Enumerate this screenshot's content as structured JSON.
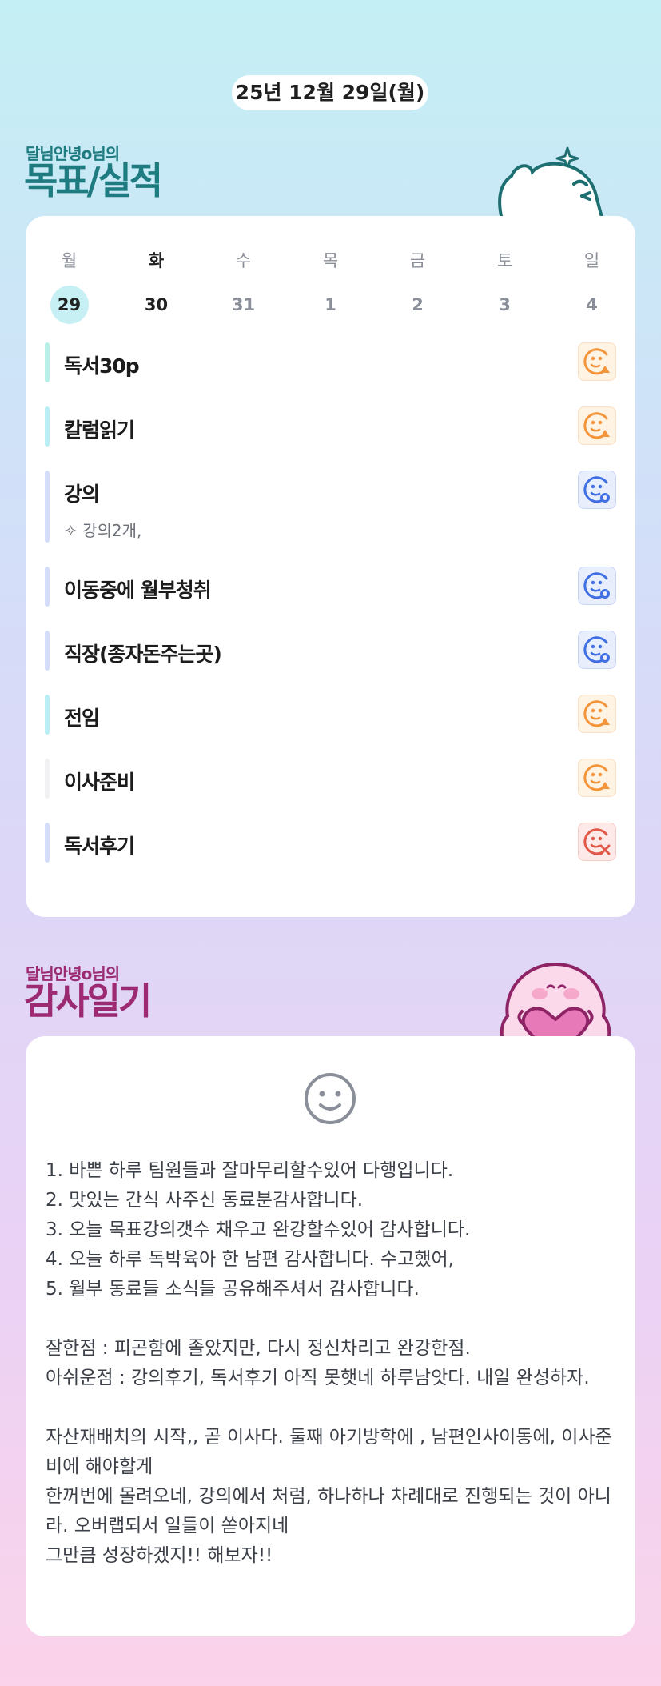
{
  "date": "25년 12월 29일(월)",
  "goals_section": {
    "subtitle": "달님안녕o님의",
    "title": "목표/실적"
  },
  "week": {
    "days": [
      "월",
      "화",
      "수",
      "목",
      "금",
      "토",
      "일"
    ],
    "dates": [
      "29",
      "30",
      "31",
      "1",
      "2",
      "3",
      "4"
    ],
    "today_index": 0,
    "bold_index": 1
  },
  "goals": [
    {
      "label": "독서30p",
      "bar_color": "#b8f0e8",
      "status": "triangle",
      "sub": ""
    },
    {
      "label": "칼럼읽기",
      "bar_color": "#b8eef4",
      "status": "triangle",
      "sub": ""
    },
    {
      "label": "강의",
      "bar_color": "#d4dcfa",
      "status": "circle",
      "sub": "강의2개,"
    },
    {
      "label": "이동중에 월부청취",
      "bar_color": "#d4dcfa",
      "status": "circle",
      "sub": ""
    },
    {
      "label": "직장(종자돈주는곳)",
      "bar_color": "#d4dcfa",
      "status": "circle",
      "sub": ""
    },
    {
      "label": "전임",
      "bar_color": "#b8eef4",
      "status": "triangle",
      "sub": ""
    },
    {
      "label": "이사준비",
      "bar_color": "#f1f1f3",
      "status": "triangle",
      "sub": ""
    },
    {
      "label": "독서후기",
      "bar_color": "#d4dcfa",
      "status": "x",
      "sub": ""
    }
  ],
  "gratitude_section": {
    "subtitle": "달님안녕o님의",
    "title": "감사일기"
  },
  "diary_lines": [
    "1.  바쁜 하루 팀원들과 잘마무리할수있어 다행입니다.",
    "2. 맛있는 간식 사주신 동료분감사합니다.",
    "3.  오늘 목표강의갯수 채우고 완강할수있어 감사합니다.",
    "4.  오늘 하루 독박육아 한 남편 감사합니다. 수고했어,",
    "5.  월부 동료들 소식들 공유해주셔서 감사합니다.",
    "",
    "잘한점 :  피곤함에  졸았지만, 다시 정신차리고 완강한점.",
    "아쉬운점 : 강의후기, 독서후기 아직 못햇네 하루남앗다. 내일 완성하자.",
    "",
    "자산재배치의 시작,, 곧 이사다. 둘째  아기방학에 , 남편인사이동에, 이사준비에 해야할게",
    "한꺼번에 몰려오네, 강의에서 처럼, 하나하나 차례대로 진행되는 것이 아니라. 오버랩되서 일들이 쏟아지네",
    "그만큼 성장하겠지!!  해보자!!"
  ],
  "colors": {
    "title_teal": "#1e7b80",
    "title_magenta": "#9b2a72",
    "triangle_face": "#f2943a",
    "circle_face": "#3f6fe0",
    "x_face": "#e05848"
  }
}
